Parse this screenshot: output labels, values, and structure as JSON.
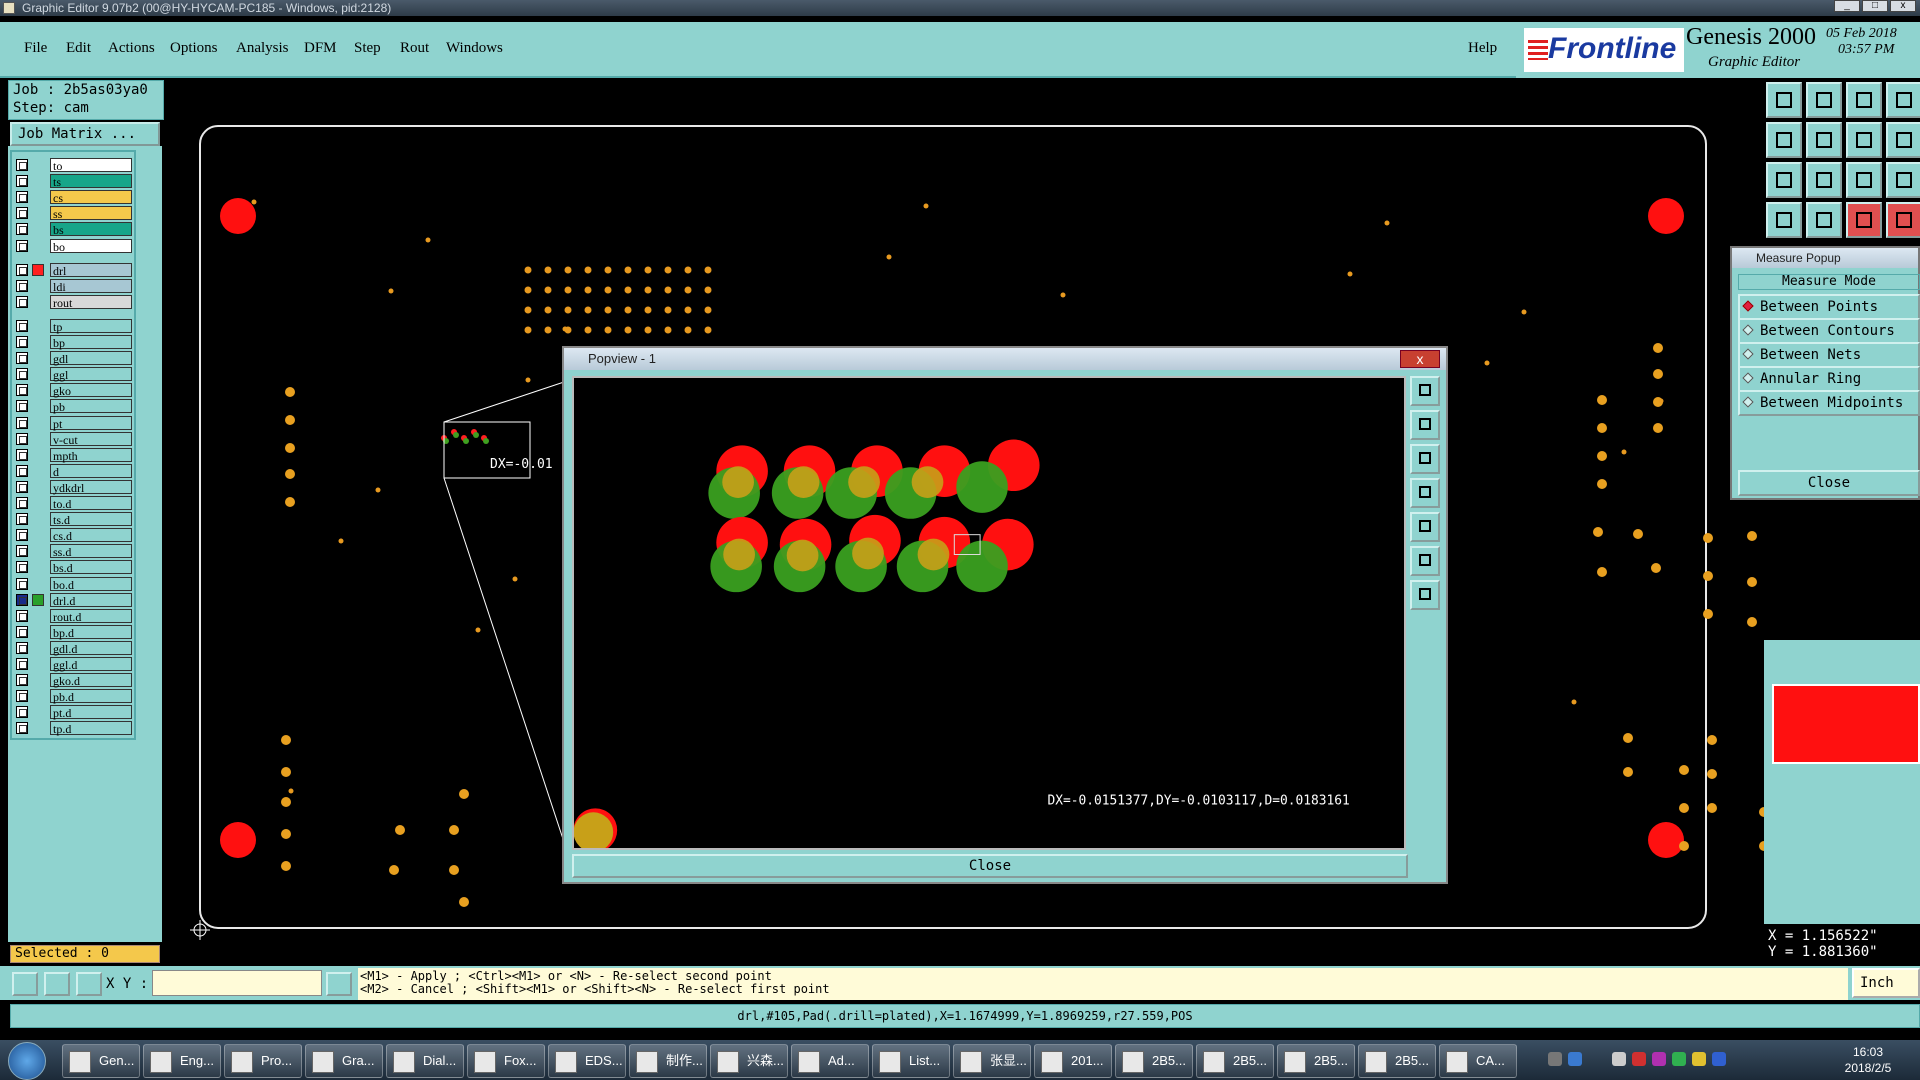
{
  "window": {
    "title": "Graphic Editor 9.07b2 (00@HY-HYCAM-PC185 - Windows, pid:2128)"
  },
  "menu": {
    "items": [
      "File",
      "Edit",
      "Actions",
      "Options",
      "Analysis",
      "DFM",
      "Step",
      "Rout",
      "Windows"
    ],
    "help": "Help"
  },
  "brand": {
    "logo": "Frontline",
    "product": "Genesis 2000",
    "subtitle": "Graphic Editor",
    "date": "05 Feb 2018",
    "time": "03:57 PM"
  },
  "job": {
    "job_label": "Job : 2b5as03ya0",
    "step_label": "Step: cam",
    "matrix_button": "Job Matrix ..."
  },
  "layers": [
    {
      "name": "to",
      "color": "#ffffff"
    },
    {
      "name": "ts",
      "color": "#17a589"
    },
    {
      "name": "cs",
      "color": "#f4c84b"
    },
    {
      "name": "ss",
      "color": "#f4c84b"
    },
    {
      "name": "bs",
      "color": "#17a589"
    },
    {
      "name": "bo",
      "color": "#ffffff"
    },
    {
      "name": "drl",
      "color": "#a7c7d3",
      "swatch": "#ff2020"
    },
    {
      "name": "ldi",
      "color": "#a7c7d3"
    },
    {
      "name": "rout",
      "color": "#d8d8d8"
    },
    {
      "name": "tp",
      "color": "#8fd3cf"
    },
    {
      "name": "bp",
      "color": "#8fd3cf"
    },
    {
      "name": "gdl",
      "color": "#8fd3cf"
    },
    {
      "name": "ggl",
      "color": "#8fd3cf"
    },
    {
      "name": "gko",
      "color": "#8fd3cf"
    },
    {
      "name": "pb",
      "color": "#8fd3cf"
    },
    {
      "name": "pt",
      "color": "#8fd3cf"
    },
    {
      "name": "v-cut",
      "color": "#8fd3cf"
    },
    {
      "name": "mpth",
      "color": "#8fd3cf"
    },
    {
      "name": "d",
      "color": "#8fd3cf"
    },
    {
      "name": "ydkdrl",
      "color": "#8fd3cf"
    },
    {
      "name": "to.d",
      "color": "#8fd3cf"
    },
    {
      "name": "ts.d",
      "color": "#8fd3cf"
    },
    {
      "name": "cs.d",
      "color": "#8fd3cf"
    },
    {
      "name": "ss.d",
      "color": "#8fd3cf"
    },
    {
      "name": "bs.d",
      "color": "#8fd3cf"
    },
    {
      "name": "bo.d",
      "color": "#8fd3cf"
    },
    {
      "name": "drl.d",
      "color": "#8fd3cf",
      "swatch": "#2aa02a",
      "active": true
    },
    {
      "name": "rout.d",
      "color": "#8fd3cf"
    },
    {
      "name": "bp.d",
      "color": "#8fd3cf"
    },
    {
      "name": "gdl.d",
      "color": "#8fd3cf"
    },
    {
      "name": "ggl.d",
      "color": "#8fd3cf"
    },
    {
      "name": "gko.d",
      "color": "#8fd3cf"
    },
    {
      "name": "pb.d",
      "color": "#8fd3cf"
    },
    {
      "name": "pt.d",
      "color": "#8fd3cf"
    },
    {
      "name": "tp.d",
      "color": "#8fd3cf"
    }
  ],
  "selected": "Selected : 0",
  "main_canvas": {
    "measure_text": "DX=-0.01"
  },
  "popview": {
    "title": "Popview - 1",
    "close_x": "x",
    "measure": "DX=-0.0151377,DY=-0.0103117,D=0.0183161",
    "close_button": "Close"
  },
  "measure_popup": {
    "title": "Measure Popup",
    "header": "Measure Mode",
    "options": [
      "Between Points",
      "Between Contours",
      "Between Nets",
      "Annular Ring",
      "Between Midpoints"
    ],
    "active_index": 0,
    "close": "Close"
  },
  "coords": {
    "x": "X = 1.156522\"",
    "y": "Y = 1.881360\""
  },
  "statusbar": {
    "xy_label": "X Y :",
    "hint_line1": "<M1> - Apply  ; <Ctrl><M1> or <N> - Re-select second point",
    "hint_line2": "<M2> - Cancel ; <Shift><M1> or <Shift><N> - Re-select first point",
    "unit": "Inch"
  },
  "feature_info": "drl,#105,Pad(.drill=plated),X=1.1674999,Y=1.8969259,r27.559,POS",
  "taskbar": {
    "items": [
      "Gen...",
      "Eng...",
      "Pro...",
      "Gra...",
      "Dial...",
      "Fox...",
      "EDS...",
      "制作...",
      "兴森...",
      "Ad...",
      "List...",
      "张显...",
      "201...",
      "2B5...",
      "2B5...",
      "2B5...",
      "2B5...",
      "CA..."
    ],
    "time": "16:03",
    "date": "2018/2/5"
  }
}
